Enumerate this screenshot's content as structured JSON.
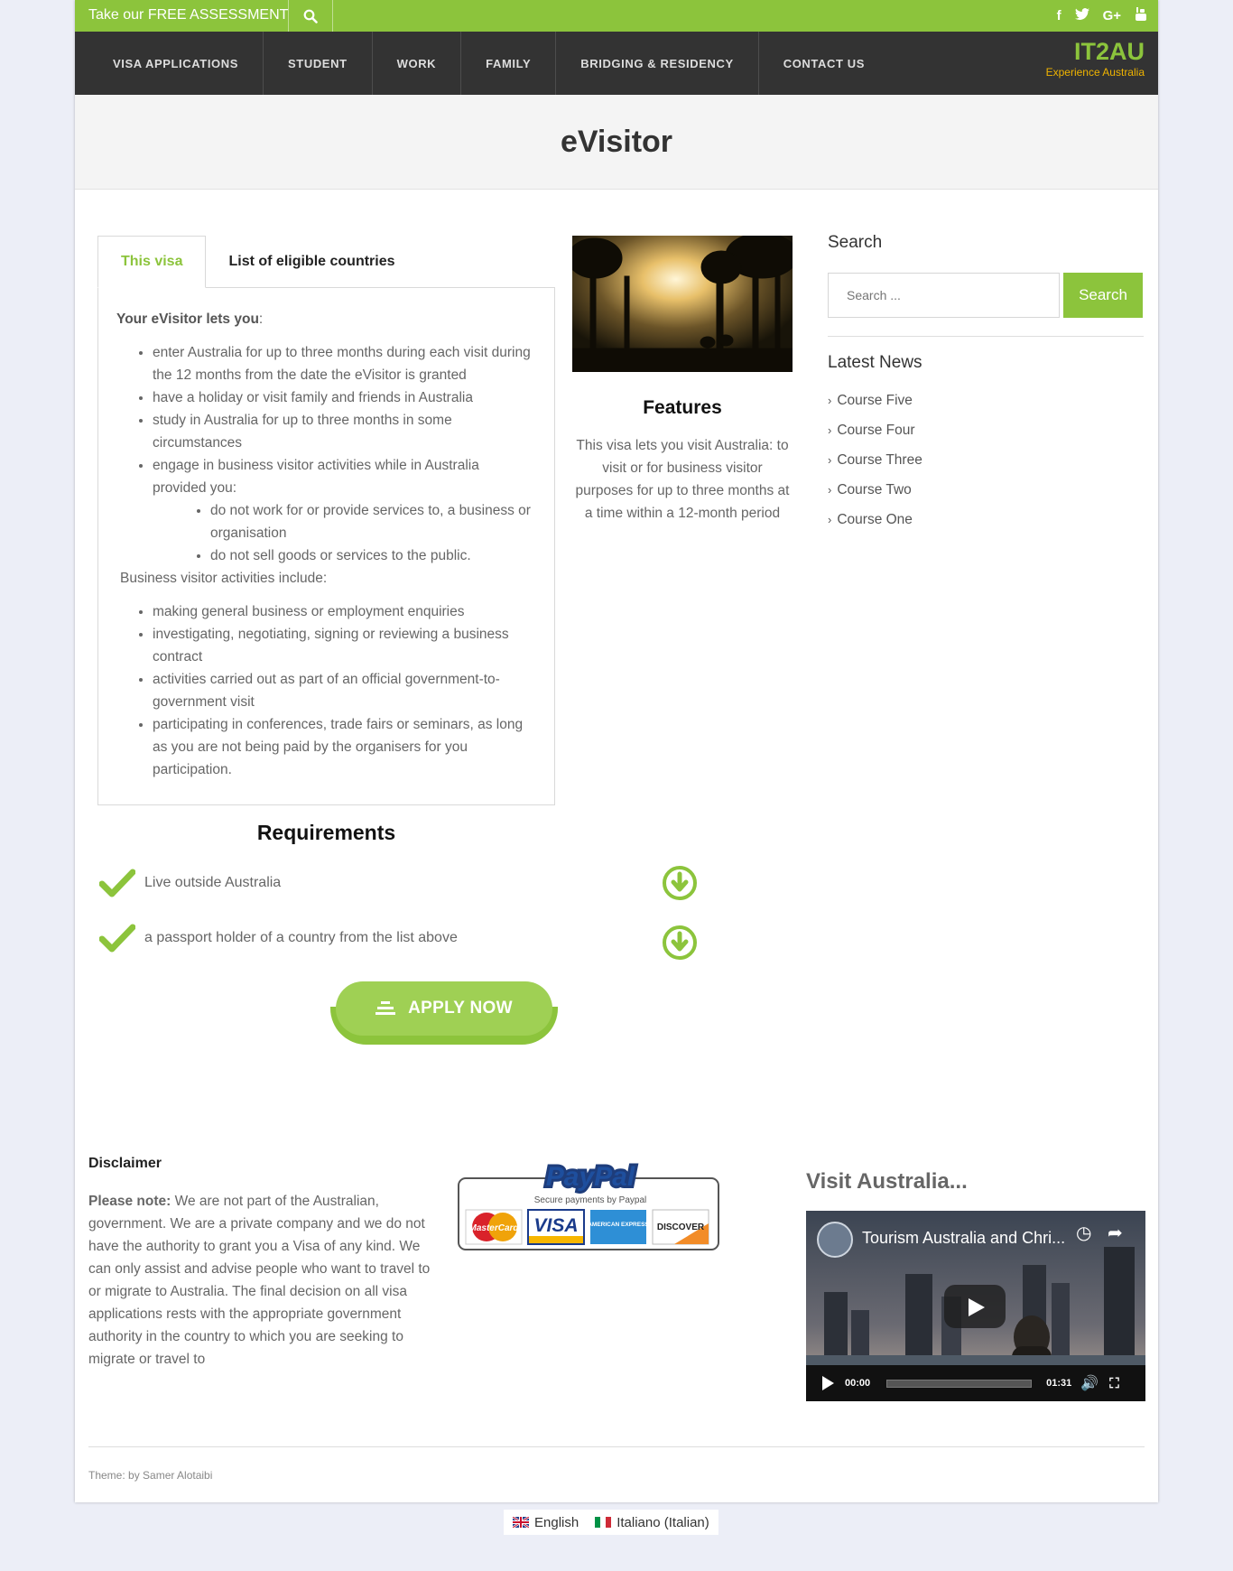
{
  "topbar": {
    "promo": "Take our FREE ASSESSMENT",
    "social": [
      "f",
      "t",
      "G+",
      "yt"
    ]
  },
  "nav": {
    "items": [
      "VISA APPLICATIONS",
      "STUDENT",
      "WORK",
      "FAMILY",
      "BRIDGING & RESIDENCY",
      "CONTACT US"
    ],
    "brand": "IT2AU",
    "tagline": "Experience Australia"
  },
  "page": {
    "title": "eVisitor"
  },
  "tabs": {
    "labels": [
      "This visa",
      "List of eligible countries"
    ],
    "lead_bold": "Your eVisitor lets you",
    "lead_rest": ":",
    "bullets": [
      "enter Australia for up to three months during each visit during the 12 months from the date the eVisitor is granted",
      "have a holiday or visit family and friends in Australia",
      "study in Australia for up to three months in some circumstances",
      "engage in business visitor activities while in Australia provided you:"
    ],
    "sub_bullets": [
      "do not work for or provide services to, a business or organisation",
      "do not sell goods or services to the public."
    ],
    "mid_text": "Business visitor activities include:",
    "activities": [
      "making general business or employment enquiries",
      "investigating, negotiating, signing or reviewing a business contract",
      "activities carried out as part of an official government-to-government visit",
      "participating in conferences, trade fairs or seminars, as long as you are not being paid by the organisers for you participation."
    ]
  },
  "features": {
    "title": "Features",
    "text": "This visa lets you visit Australia: to visit or for business visitor purposes for up to three months at a time within a 12-month period"
  },
  "sidebar": {
    "search_title": "Search",
    "search_placeholder": "Search ...",
    "search_button": "Search",
    "news_title": "Latest News",
    "news": [
      "Course Five",
      "Course Four",
      "Course Three",
      "Course Two",
      "Course One"
    ]
  },
  "requirements": {
    "title": "Requirements",
    "items": [
      "Live outside Australia",
      "a passport holder of a country from the list above"
    ]
  },
  "apply": {
    "label": "APPLY NOW"
  },
  "footer": {
    "disclaimer_title": "Disclaimer",
    "note_bold": "Please note:",
    "note_text": " We are not part of the Australian, government. We are a private company and we do not have the authority to grant you a Visa of any kind. We can only assist and advise people who want to travel to or migrate to Australia. The final decision on all visa applications rests with the appropriate government authority in the country to which you are seeking to migrate or travel to",
    "paypal": {
      "brand": "PayPal",
      "caption": "Secure payments by Paypal",
      "cards": [
        "MasterCard",
        "VISA",
        "AMERICAN EXPRESS",
        "DISCOVER"
      ]
    },
    "visit_title": "Visit Australia...",
    "video_title": "Tourism Australia and Chri...",
    "video_current": "00:00",
    "video_duration": "01:31",
    "credit": "Theme: by Samer Alotaibi"
  },
  "languages": [
    "English",
    "Italiano (Italian)"
  ],
  "colors": {
    "accent": "#8cc43c",
    "nav_bg": "#333333",
    "tagline": "#f0b400"
  }
}
